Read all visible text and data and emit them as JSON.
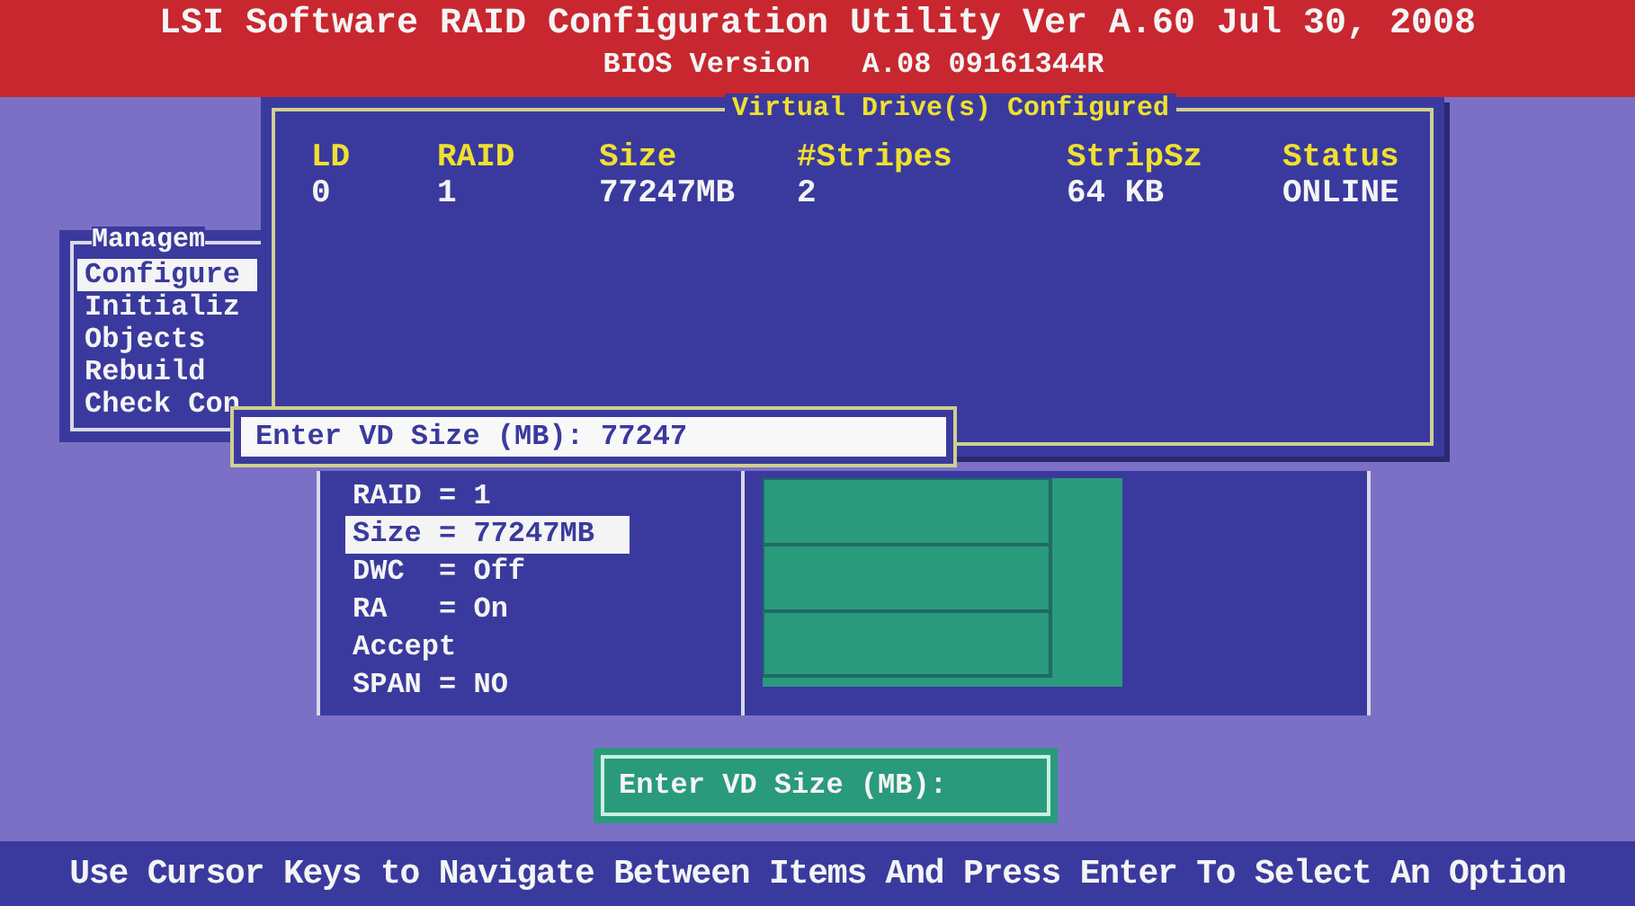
{
  "header": {
    "title": "LSI Software RAID Configuration Utility Ver A.60 Jul 30, 2008",
    "subtitle": "BIOS Version   A.08 09161344R"
  },
  "management_menu": {
    "title": "Managem",
    "items": [
      {
        "label": "Configure",
        "selected": true
      },
      {
        "label": "Initializ",
        "selected": false
      },
      {
        "label": "Objects",
        "selected": false
      },
      {
        "label": "Rebuild",
        "selected": false
      },
      {
        "label": "Check Con",
        "selected": false
      }
    ]
  },
  "vd_window": {
    "title": "Virtual Drive(s) Configured",
    "columns": [
      "LD",
      "RAID",
      "Size",
      "#Stripes",
      "StripSz",
      "Status"
    ],
    "rows": [
      [
        "0",
        "1",
        "77247MB",
        "2",
        "64 KB",
        "ONLINE"
      ]
    ]
  },
  "size_input": {
    "label": "Enter VD Size (MB):",
    "value": "77247"
  },
  "properties_menu": {
    "items": [
      {
        "label": "RAID = 1",
        "selected": false
      },
      {
        "label": "Size = 77247MB",
        "selected": true
      },
      {
        "label": "DWC  = Off",
        "selected": false
      },
      {
        "label": "RA   = On",
        "selected": false
      },
      {
        "label": "Accept",
        "selected": false
      },
      {
        "label": "SPAN = NO",
        "selected": false
      }
    ]
  },
  "prompt": "Enter VD Size (MB):",
  "status_bar": "Use Cursor Keys to Navigate Between Items And Press Enter To Select An Option"
}
